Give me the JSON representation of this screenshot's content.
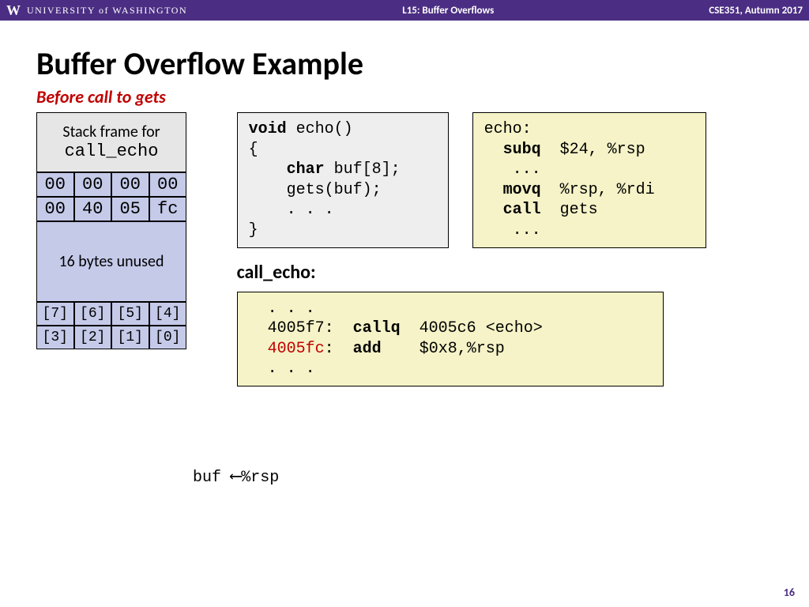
{
  "header": {
    "logo": "W",
    "univ": "UNIVERSITY of WASHINGTON",
    "lecture": "L15:  Buffer Overflows",
    "course": "CSE351, Autumn 2017"
  },
  "title": "Buffer Overflow Example",
  "subtitle": "Before call to gets",
  "stack": {
    "head_line1": "Stack frame for",
    "head_line2": "call_echo",
    "row1": [
      "00",
      "00",
      "00",
      "00"
    ],
    "row2": [
      "00",
      "40",
      "05",
      "fc"
    ],
    "unused": "16 bytes unused",
    "buf_row1": [
      "[7]",
      "[6]",
      "[5]",
      "[4]"
    ],
    "buf_row2": [
      "[3]",
      "[2]",
      "[1]",
      "[0]"
    ]
  },
  "rsp": {
    "buf": "buf",
    "arrow": "⟵",
    "reg": "%rsp"
  },
  "code_c": {
    "l1a": "void",
    "l1b": " echo()",
    "l2": "{",
    "l3a": "    ",
    "l3b": "char",
    "l3c": " buf[8];",
    "l4": "    gets(buf);",
    "l5": "    . . .",
    "l6": "}"
  },
  "asm1": {
    "l1": "echo:",
    "l2a": "  ",
    "l2b": "subq",
    "l2c": "  $24, %rsp",
    "l3": "   ...",
    "l4a": "  ",
    "l4b": "movq",
    "l4c": "  %rsp, %rdi",
    "l5a": "  ",
    "l5b": "call",
    "l5c": "  gets",
    "l6": "   ..."
  },
  "section": "call_echo:",
  "asm2": {
    "l1": "  . . .",
    "l2a": "  4005f7:  ",
    "l2b": "callq",
    "l2c": "  4005c6 <echo>",
    "l3a": "  ",
    "l3b": "4005fc",
    "l3c": ":  ",
    "l3d": "add",
    "l3e": "    $0x8,%rsp",
    "l4": "  . . ."
  },
  "pagenum": "16"
}
